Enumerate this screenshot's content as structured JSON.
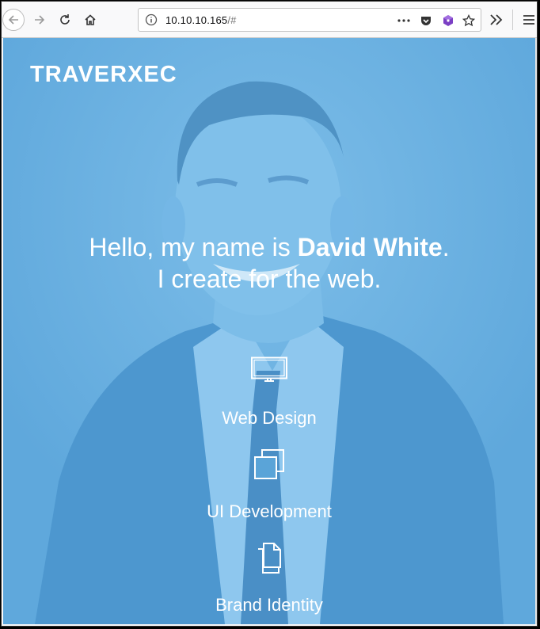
{
  "browser": {
    "url_host": "10.10.10.165",
    "url_path": "/#"
  },
  "site": {
    "brand": "TRAVERXEC",
    "headline_prefix": "Hello, my name is ",
    "headline_name": "David White",
    "headline_suffix": ".",
    "headline_line2": "I create for the web.",
    "services": [
      {
        "label": "Web Design",
        "icon": "monitor-icon"
      },
      {
        "label": "UI Development",
        "icon": "stacked-windows-icon"
      },
      {
        "label": "Brand Identity",
        "icon": "documents-icon"
      }
    ]
  },
  "colors": {
    "hero_overlay": "#64ade0",
    "text": "#ffffff"
  }
}
